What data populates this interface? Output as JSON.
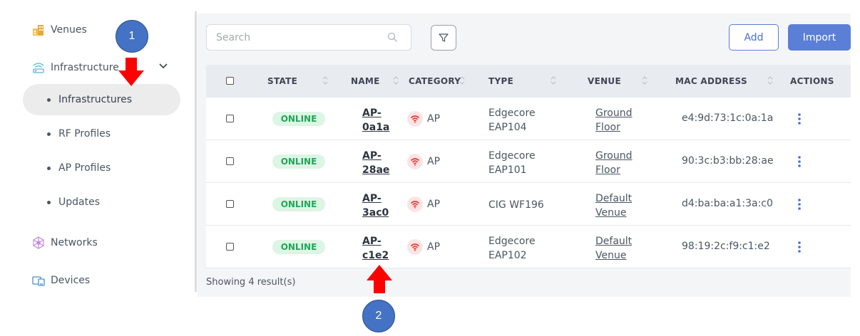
{
  "sidebar": {
    "venues": "Venues",
    "infrastructure": "Infrastructure",
    "sub": [
      "Infrastructures",
      "RF Profiles",
      "AP Profiles",
      "Updates"
    ],
    "networks": "Networks",
    "devices": "Devices"
  },
  "toolbar": {
    "search_placeholder": "Search",
    "add_label": "Add",
    "import_label": "Import"
  },
  "table": {
    "headers": [
      "STATE",
      "NAME",
      "CATEGORY",
      "TYPE",
      "VENUE",
      "MAC ADDRESS",
      "ACTIONS"
    ],
    "rows": [
      {
        "state": "ONLINE",
        "name1": "AP-",
        "name2": "0a1a",
        "category": "AP",
        "type1": "Edgecore",
        "type2": "EAP104",
        "venue1": "Ground",
        "venue2": "Floor",
        "mac": "e4:9d:73:1c:0a:1a"
      },
      {
        "state": "ONLINE",
        "name1": "AP-",
        "name2": "28ae",
        "category": "AP",
        "type1": "Edgecore",
        "type2": "EAP101",
        "venue1": "Ground",
        "venue2": "Floor",
        "mac": "90:3c:b3:bb:28:ae"
      },
      {
        "state": "ONLINE",
        "name1": "AP-",
        "name2": "3ac0",
        "category": "AP",
        "type1": "CIG WF196",
        "type2": "",
        "venue1": "Default",
        "venue2": "Venue",
        "mac": "d4:ba:ba:a1:3a:c0"
      },
      {
        "state": "ONLINE",
        "name1": "AP-",
        "name2": "c1e2",
        "category": "AP",
        "type1": "Edgecore",
        "type2": "EAP102",
        "venue1": "Default",
        "venue2": "Venue",
        "mac": "98:19:2c:f9:c1:e2"
      }
    ],
    "footer": "Showing 4 result(s)"
  },
  "annotations": {
    "callout1": "1",
    "callout2": "2",
    "arrow_color": "#ff0000"
  },
  "colors": {
    "accent": "#5b7fd6",
    "online_bg": "#dcf5e4",
    "online_text": "#22a55a",
    "wifi_icon": "#e53935"
  }
}
